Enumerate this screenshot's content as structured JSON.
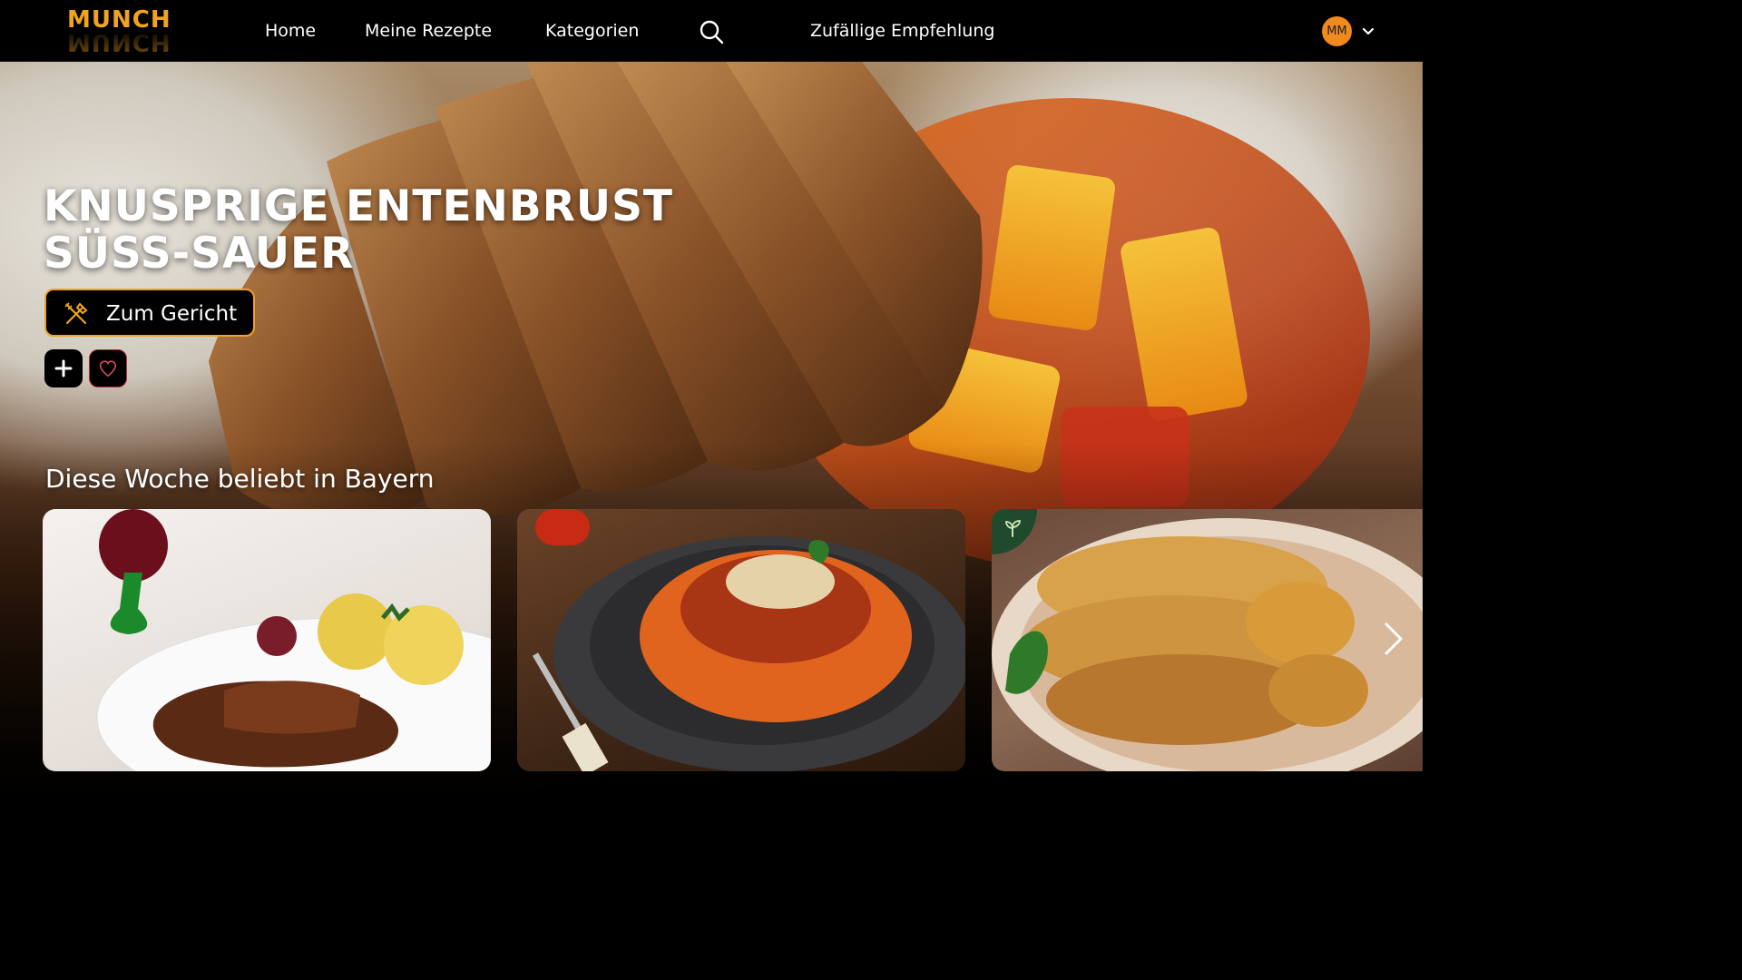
{
  "brand": {
    "logo_text": "MUNCH",
    "accent": "#f2a31c"
  },
  "nav": {
    "home": "Home",
    "my_recipes": "Meine Rezepte",
    "categories": "Kategorien",
    "search_icon": "search-icon",
    "random": "Zufällige Empfehlung"
  },
  "user": {
    "initials": "MM",
    "avatar_color": "#f08a1c"
  },
  "hero": {
    "title_line1": "KNUSPRIGE ENTENBRUST",
    "title_line2": "SÜSS-SAUER",
    "cta_label": "Zum Gericht",
    "cta_icon": "cutlery-icon",
    "add_icon": "plus-icon",
    "fav_icon": "heart-icon"
  },
  "section": {
    "title": "Diese Woche beliebt in Bayern",
    "cards": [
      {
        "image": "roast-with-dumplings",
        "vegetarian": false
      },
      {
        "image": "spaghetti-bolognese",
        "vegetarian": false
      },
      {
        "image": "potato-pancakes-applesauce",
        "vegetarian": true,
        "badge_icon": "sprout-icon"
      }
    ],
    "next_icon": "chevron-right-icon"
  }
}
